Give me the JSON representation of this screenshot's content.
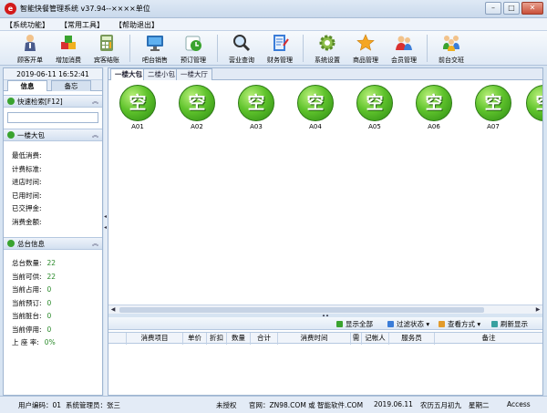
{
  "window": {
    "title": "智能快餐管理系统 v37.94--××××单位",
    "icon_glyph": "e",
    "minimize": "–",
    "maximize": "□",
    "close": "✕"
  },
  "menu": [
    "【系统功能】",
    "【常用工具】",
    "【帮助退出】"
  ],
  "toolbar": [
    {
      "label": "顾客开单",
      "icon": "waiter-icon"
    },
    {
      "label": "增加消费",
      "icon": "cubes-icon"
    },
    {
      "label": "宾客结账",
      "icon": "calculator-icon"
    },
    {
      "label": "吧台销售",
      "icon": "monitor-icon"
    },
    {
      "label": "预订管理",
      "icon": "clock-icon"
    },
    {
      "label": "营业查询",
      "icon": "magnifier-icon"
    },
    {
      "label": "财务管理",
      "icon": "notebook-icon"
    },
    {
      "label": "系统设置",
      "icon": "gear-icon"
    },
    {
      "label": "商品管理",
      "icon": "star-icon"
    },
    {
      "label": "会员管理",
      "icon": "members-icon"
    },
    {
      "label": "前台交班",
      "icon": "handover-icon"
    }
  ],
  "left": {
    "datetime": "2019-06-11 16:52:41",
    "tabs": [
      "信息",
      "备忘"
    ],
    "quick_search": "快速检索[F12]",
    "room_section": "一楼大包",
    "room_fields": [
      "最低消费:",
      "计费标准:",
      "进店时间:",
      "已用时间:",
      "已交押金:",
      "消费金额:"
    ],
    "stats_section": "总台信息",
    "stats": [
      {
        "label": "总台数量:",
        "value": "22"
      },
      {
        "label": "当前可供:",
        "value": "22"
      },
      {
        "label": "当前占用:",
        "value": "0"
      },
      {
        "label": "当前预订:",
        "value": "0"
      },
      {
        "label": "当前脏台:",
        "value": "0"
      },
      {
        "label": "当前停用:",
        "value": "0"
      },
      {
        "label": "上 座 率:",
        "value": "0%"
      }
    ]
  },
  "room_tabs": [
    "一楼大包",
    "二楼小包",
    "一楼大厅"
  ],
  "rooms": [
    {
      "name": "A01",
      "status": "空"
    },
    {
      "name": "A02",
      "status": "空"
    },
    {
      "name": "A03",
      "status": "空"
    },
    {
      "name": "A04",
      "status": "空"
    },
    {
      "name": "A05",
      "status": "空"
    },
    {
      "name": "A06",
      "status": "空"
    },
    {
      "name": "A07",
      "status": "空"
    },
    {
      "name": "",
      "status": "空"
    }
  ],
  "order_toolbar": [
    "显示全部",
    "过滤状态 ▾",
    "查看方式 ▾",
    "刷新显示"
  ],
  "grid_columns": [
    "消费项目",
    "单价",
    "折扣",
    "数量",
    "合计",
    "消费时间",
    "需",
    "记帐人",
    "服务员",
    "备注"
  ],
  "status": {
    "user": "用户编码：01",
    "operator": "系统管理员：张三",
    "license": "未授权",
    "website": "官网：ZN98.COM 或 智能软件.COM",
    "date": "2019.06.11",
    "lunar": "农历五月初九",
    "weekday": "星期二",
    "db": "Access"
  }
}
